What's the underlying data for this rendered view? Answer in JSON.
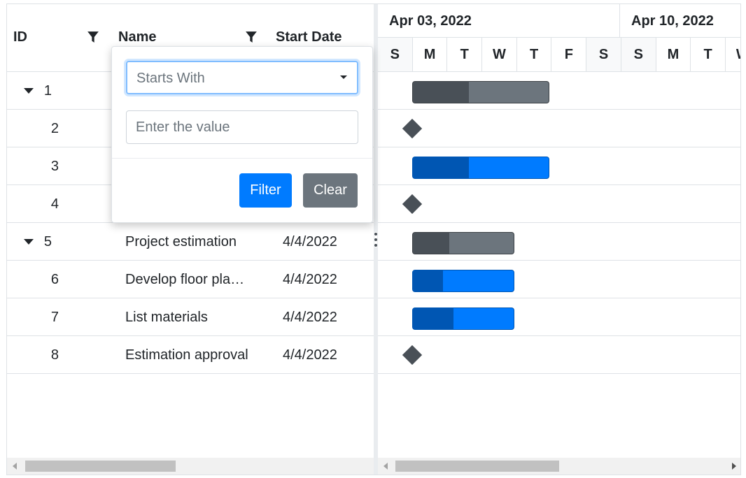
{
  "grid": {
    "columns": {
      "id": "ID",
      "name": "Name",
      "start_date": "Start Date"
    },
    "rows": [
      {
        "id": "1",
        "name": "",
        "start_date": "",
        "expandable": true
      },
      {
        "id": "2",
        "name": "",
        "start_date": "",
        "expandable": false
      },
      {
        "id": "3",
        "name": "",
        "start_date": "",
        "expandable": false
      },
      {
        "id": "4",
        "name": "",
        "start_date": "",
        "expandable": false
      },
      {
        "id": "5",
        "name": "Project estimation",
        "start_date": "4/4/2022",
        "expandable": true
      },
      {
        "id": "6",
        "name": "Develop floor pla…",
        "start_date": "4/4/2022",
        "expandable": false
      },
      {
        "id": "7",
        "name": "List materials",
        "start_date": "4/4/2022",
        "expandable": false
      },
      {
        "id": "8",
        "name": "Estimation approval",
        "start_date": "4/4/2022",
        "expandable": false
      }
    ]
  },
  "timeline": {
    "weeks": [
      "Apr 03, 2022",
      "Apr 10, 2022"
    ],
    "days": [
      "S",
      "M",
      "T",
      "W",
      "T",
      "F",
      "S",
      "S",
      "M",
      "T",
      "W"
    ]
  },
  "chart": {
    "rows": [
      {
        "kind": "parent",
        "progress": 0.41
      },
      {
        "kind": "milestone"
      },
      {
        "kind": "child",
        "progress": 0.41
      },
      {
        "kind": "milestone"
      },
      {
        "kind": "parent",
        "progress": 0.36
      },
      {
        "kind": "child",
        "progress": 0.3
      },
      {
        "kind": "child",
        "progress": 0.4
      },
      {
        "kind": "milestone"
      }
    ]
  },
  "filter_popup": {
    "operator": "Starts With",
    "value_placeholder": "Enter the value",
    "value": "",
    "filter_label": "Filter",
    "clear_label": "Clear"
  },
  "colors": {
    "primary": "#007bff",
    "secondary": "#6c757d",
    "parent_progress": "#495057",
    "child_progress": "#0056b3"
  }
}
